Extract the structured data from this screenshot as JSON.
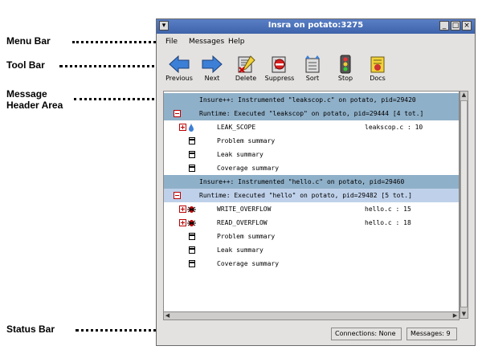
{
  "callouts": {
    "menu_bar": "Menu Bar",
    "tool_bar": "Tool Bar",
    "message_header_area_line1": "Message",
    "message_header_area_line2": "Header Area",
    "status_bar": "Status Bar"
  },
  "window": {
    "title": "Insra on potato:3275",
    "controls": {
      "minimize": "_",
      "maximize": "□",
      "close": "×",
      "menu": "▾"
    }
  },
  "menubar": {
    "file": "File",
    "messages": "Messages",
    "help": "Help"
  },
  "toolbar": {
    "previous": "Previous",
    "next": "Next",
    "delete": "Delete",
    "suppress": "Suppress",
    "sort": "Sort",
    "stop": "Stop",
    "docs": "Docs"
  },
  "messages": {
    "row1": {
      "text": "Insure++: Instrumented \"leakscop.c\" on potato, pid=29420"
    },
    "row2": {
      "text": "Runtime: Executed \"leakscop\" on potato, pid=29444  [4 tot.]"
    },
    "row3": {
      "text": "LEAK_SCOPE",
      "file": "leakscop.c : 10"
    },
    "row4": {
      "text": "Problem summary"
    },
    "row5": {
      "text": "Leak summary"
    },
    "row6": {
      "text": "Coverage summary"
    },
    "row7": {
      "text": "Insure++: Instrumented \"hello.c\" on potato, pid=29460"
    },
    "row8": {
      "text": "Runtime: Executed \"hello\" on potato, pid=29482  [5 tot.]"
    },
    "row9": {
      "text": "WRITE_OVERFLOW",
      "file": "hello.c : 15"
    },
    "row10": {
      "text": "READ_OVERFLOW",
      "file": "hello.c : 18"
    },
    "row11": {
      "text": "Problem summary"
    },
    "row12": {
      "text": "Leak summary"
    },
    "row13": {
      "text": "Coverage summary"
    }
  },
  "statusbar": {
    "connections": "Connections: None",
    "messages": "Messages: 9"
  },
  "colors": {
    "header_row": "#8fb0c9",
    "selected_header_row": "#bfd1ea",
    "title_bar": "#4a6fb6"
  }
}
